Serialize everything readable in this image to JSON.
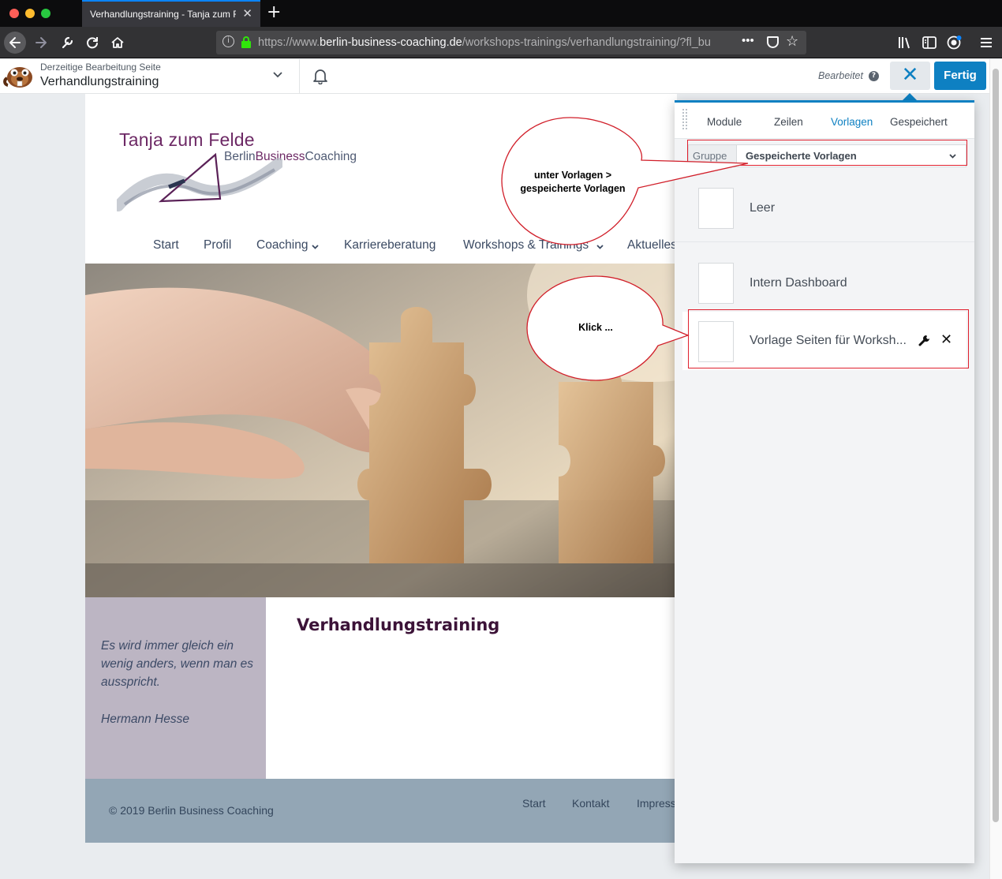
{
  "browser": {
    "tab_title": "Verhandlungstraining - Tanja zum Felde",
    "tab_close": "✕",
    "new_tab": "+",
    "url_prefix": "https://www.",
    "url_host": "berlin-business-coaching.de",
    "url_path": "/workshops-trainings/verhandlungstraining/?fl_bu",
    "url_more": "•••"
  },
  "builder": {
    "subtitle": "Derzeitige Bearbeitung Seite",
    "page_title": "Verhandlungstraining",
    "edited_label": "Bearbeitet",
    "help": "?",
    "close_button": "✕",
    "done_button": "Fertig"
  },
  "site": {
    "logo_name": "Tanja zum Felde",
    "logo_tag_a": "Berlin",
    "logo_tag_b": "Business",
    "logo_tag_c": "Coaching",
    "nav": [
      "Start",
      "Profil",
      "Coaching",
      "Karriereberatung",
      "Workshops & Trainings",
      "Aktuelles"
    ],
    "nav_dropdown_mark": "⌄",
    "quote_text": "Es wird immer gleich ein wenig anders, wenn man es ausspricht.",
    "quote_author": "Hermann Hesse",
    "heading": "Verhandlungstraining",
    "copyright": "© 2019 Berlin Business Coaching",
    "footer_links": [
      "Start",
      "Kontakt",
      "Impressum"
    ]
  },
  "callouts": {
    "top_line1": "unter Vorlagen >",
    "top_line2": "gespeicherte Vorlagen",
    "bottom": "Klick ..."
  },
  "panel": {
    "tabs": [
      "Module",
      "Zeilen",
      "Vorlagen",
      "Gespeichert"
    ],
    "active_tab": "Vorlagen",
    "group_label": "Gruppe",
    "group_value": "Gespeicherte Vorlagen",
    "templates": [
      "Leer",
      "Intern Dashboard",
      "Vorlage Seiten für Worksh..."
    ],
    "delete_mark": "✕"
  },
  "colors": {
    "accent": "#0e80c2",
    "brand_purple": "#6d2965",
    "annotation_red": "#e0202e"
  }
}
